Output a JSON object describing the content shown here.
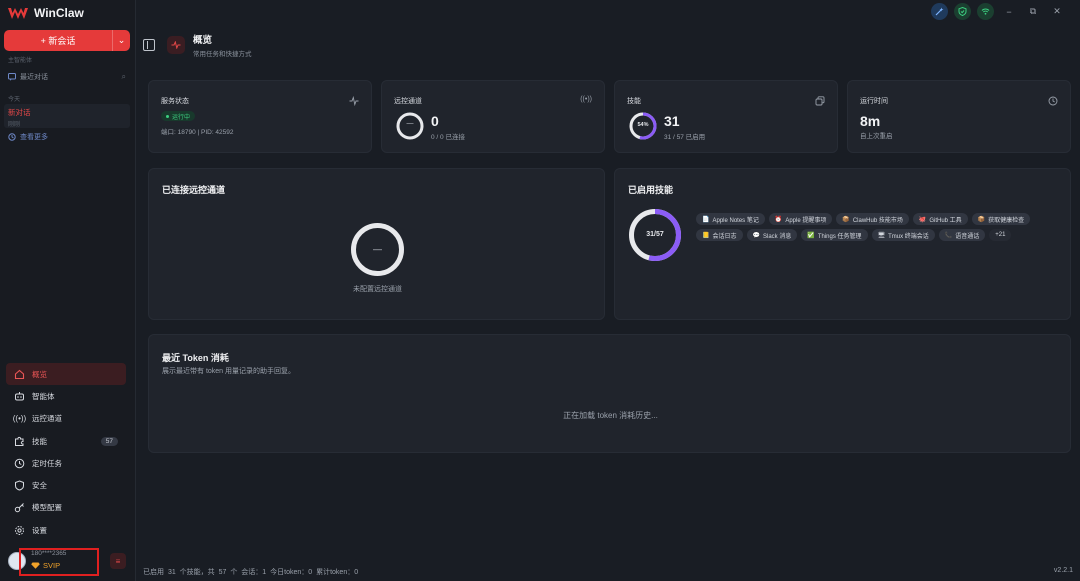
{
  "app": {
    "title": "WinClaw",
    "version": "v2.2.1"
  },
  "sidebar": {
    "new_chat_label": "+ 新会话",
    "workspace_label": "主智能体",
    "recent_label": "最近对话",
    "today_label": "今天",
    "chat_items": [
      {
        "title": "新对话",
        "subtitle": "刚刚"
      }
    ],
    "see_more_label": "查看更多",
    "nav": [
      {
        "label": "概览",
        "icon": "home-icon",
        "active": true
      },
      {
        "label": "智能体",
        "icon": "robot-icon"
      },
      {
        "label": "远控通道",
        "icon": "broadcast-icon"
      },
      {
        "label": "技能",
        "icon": "puzzle-icon",
        "badge": "57"
      },
      {
        "label": "定时任务",
        "icon": "clock-icon"
      },
      {
        "label": "安全",
        "icon": "shield-icon"
      },
      {
        "label": "模型配置",
        "icon": "key-icon"
      },
      {
        "label": "设置",
        "icon": "gear-icon"
      }
    ],
    "user": {
      "phone": "180****2365",
      "tier": "SVIP"
    }
  },
  "header": {
    "title": "概览",
    "subtitle": "常用任务和快捷方式"
  },
  "cards": {
    "service": {
      "title": "服务状态",
      "status": "运行中",
      "detail": "端口: 18790 | PID: 42592"
    },
    "channels": {
      "title": "远控通道",
      "value": "0",
      "detail": "0 / 0 已连接",
      "ring_center": "—",
      "fraction": 0
    },
    "skills": {
      "title": "技能",
      "value": "31",
      "detail": "31 / 57 已启用",
      "ring_center": "54%",
      "fraction": 0.54
    },
    "uptime": {
      "title": "运行时间",
      "value": "8m",
      "detail": "自上次重启"
    }
  },
  "connected_panel": {
    "title": "已连接远控通道",
    "ring_center": "—",
    "empty_text": "未配置远控通道"
  },
  "skills_panel": {
    "title": "已启用技能",
    "ring_center": "31/57",
    "fraction": 0.54,
    "tags": [
      {
        "emoji": "📄",
        "label": "Apple Notes 笔记"
      },
      {
        "emoji": "⏰",
        "label": "Apple 提醒事项"
      },
      {
        "emoji": "📦",
        "label": "ClawHub 技能市场"
      },
      {
        "emoji": "🐙",
        "label": "GitHub 工具"
      },
      {
        "emoji": "📦",
        "label": "获取健康检查"
      },
      {
        "emoji": "📒",
        "label": "会话日志"
      },
      {
        "emoji": "💬",
        "label": "Slack 消息"
      },
      {
        "emoji": "✅",
        "label": "Things 任务管理"
      },
      {
        "emoji": "🖥",
        "label": "Tmux 终端会话"
      },
      {
        "emoji": "📞",
        "label": "语音通话"
      }
    ],
    "more": "+21"
  },
  "token_panel": {
    "title": "最近 Token 消耗",
    "subtitle": "展示最近带有 token 用量记录的助手回复。",
    "loading": "正在加载 token 消耗历史..."
  },
  "statusbar": {
    "text": "已启用 31 个技能，共 57 个  会话：1  今日token：0  累计token：0"
  },
  "colors": {
    "accent": "#e53a3a",
    "success": "#3ccf80",
    "ring": "#8b5cf6",
    "svip": "#f0a22a"
  }
}
